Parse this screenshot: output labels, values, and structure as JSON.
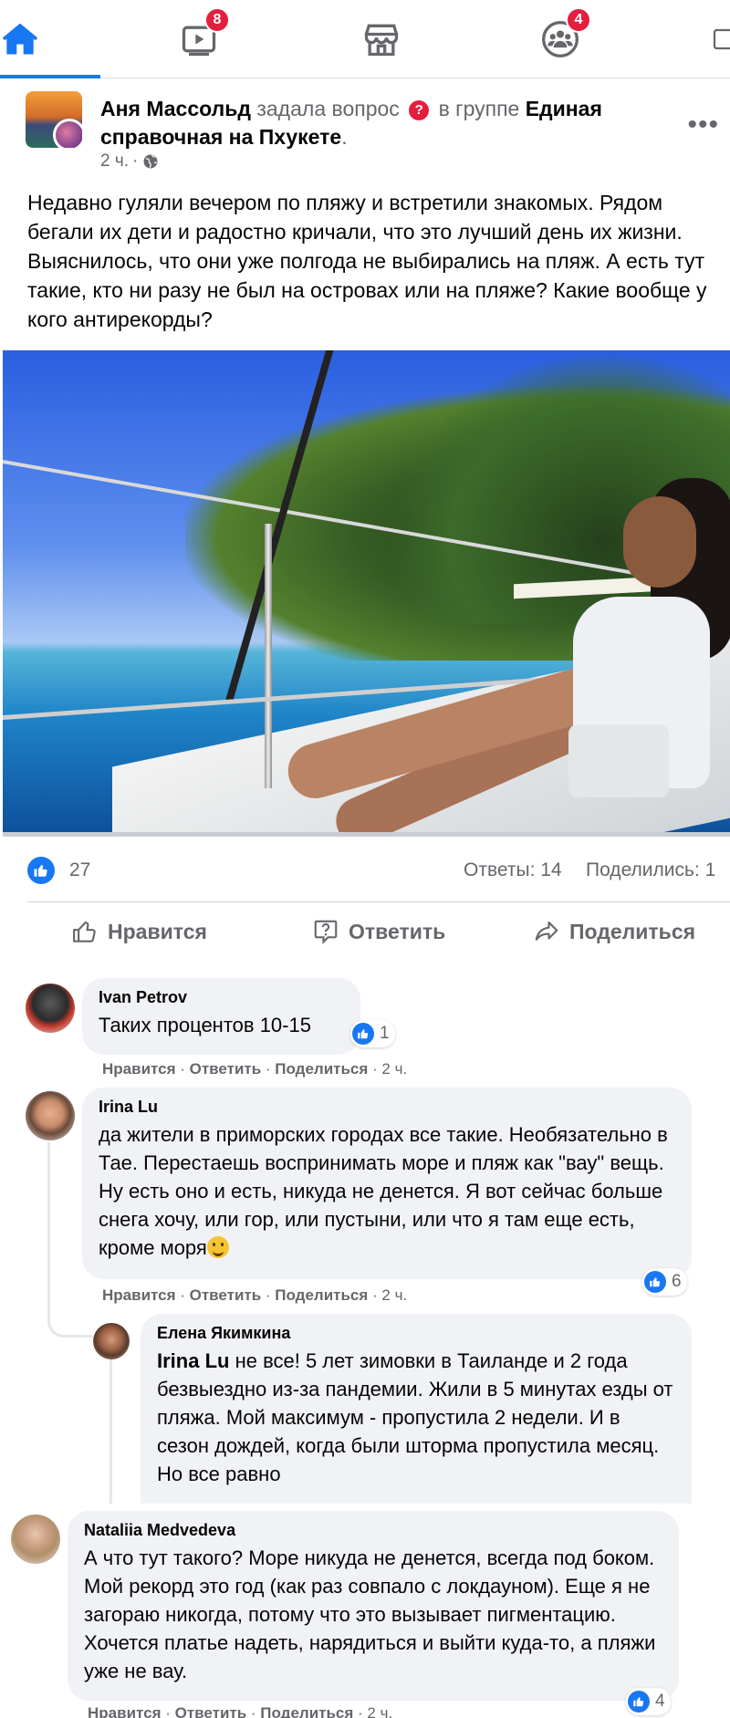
{
  "nav": {
    "tabs": [
      {
        "name": "home",
        "icon": "home-icon",
        "active": true
      },
      {
        "name": "watch",
        "icon": "video-icon",
        "badge": "8"
      },
      {
        "name": "marketplace",
        "icon": "store-icon"
      },
      {
        "name": "groups",
        "icon": "groups-icon",
        "badge": "4"
      }
    ],
    "accent_color": "#1877f2",
    "badge_color": "#e41e3f"
  },
  "post": {
    "author": "Аня Массольд",
    "action": "задала вопрос",
    "in_group_prefix": "в группе",
    "group": "Единая справочная на Пхукете",
    "group_suffix": ".",
    "time": "2 ч.",
    "separator": "·",
    "text": "Недавно гуляли вечером по пляжу и встретили знакомых. Рядом бегали их дети и радостно кричали, что это лучший день их жизни. Выяснилось, что они уже полгода не выбирались на пляж. А есть тут такие, кто ни разу не был на островах или на пляже? Какие вообще у кого антирекорды?",
    "reactions_count": "27",
    "answers": "Ответы: 14",
    "shares": "Поделились: 1"
  },
  "actions": {
    "like": "Нравится",
    "answer": "Ответить",
    "share": "Поделиться"
  },
  "comments": [
    {
      "name": "Ivan Petrov",
      "text": "Таких процентов 10-15",
      "reactions": "1",
      "meta": {
        "like": "Нравится",
        "reply": "Ответить",
        "share": "Поделиться",
        "time": "2 ч."
      }
    },
    {
      "name": "Irina Lu",
      "text": "да жители в приморских городах все такие. Необязательно в Тае. Перестаешь воспринимать море и пляж как \"вау\" вещь. Ну есть оно и есть, никуда не денется. Я вот сейчас больше снега хочу, или гор, или пустыни, или что я там еще есть, кроме моря",
      "reactions": "6",
      "meta": {
        "like": "Нравится",
        "reply": "Ответить",
        "share": "Поделиться",
        "time": "2 ч."
      }
    },
    {
      "name": "Елена Якимкина",
      "mention": "Irina Lu",
      "text": " не все! 5 лет зимовки в Таиланде и 2 года безвыездно из-за пандемии. Жили в 5 минутах езды от пляжа. Мой максимум - пропустила 2 недели. И в сезон дождей, когда были шторма пропустила месяц. Но все равно"
    },
    {
      "name": "Nataliia Medvedeva",
      "text": "А что тут такого? Море никуда не денется, всегда под боком. Мой рекорд это год (как раз совпало с локдауном). Еще я не загораю никогда, потому что это вызывает пигментацию. Хочется платье надеть, нарядиться и выйти куда-то, а пляжи уже не вау.",
      "reactions": "4",
      "meta": {
        "like": "Нравится",
        "reply": "Ответить",
        "share": "Поделиться",
        "time": "2 ч."
      }
    }
  ]
}
